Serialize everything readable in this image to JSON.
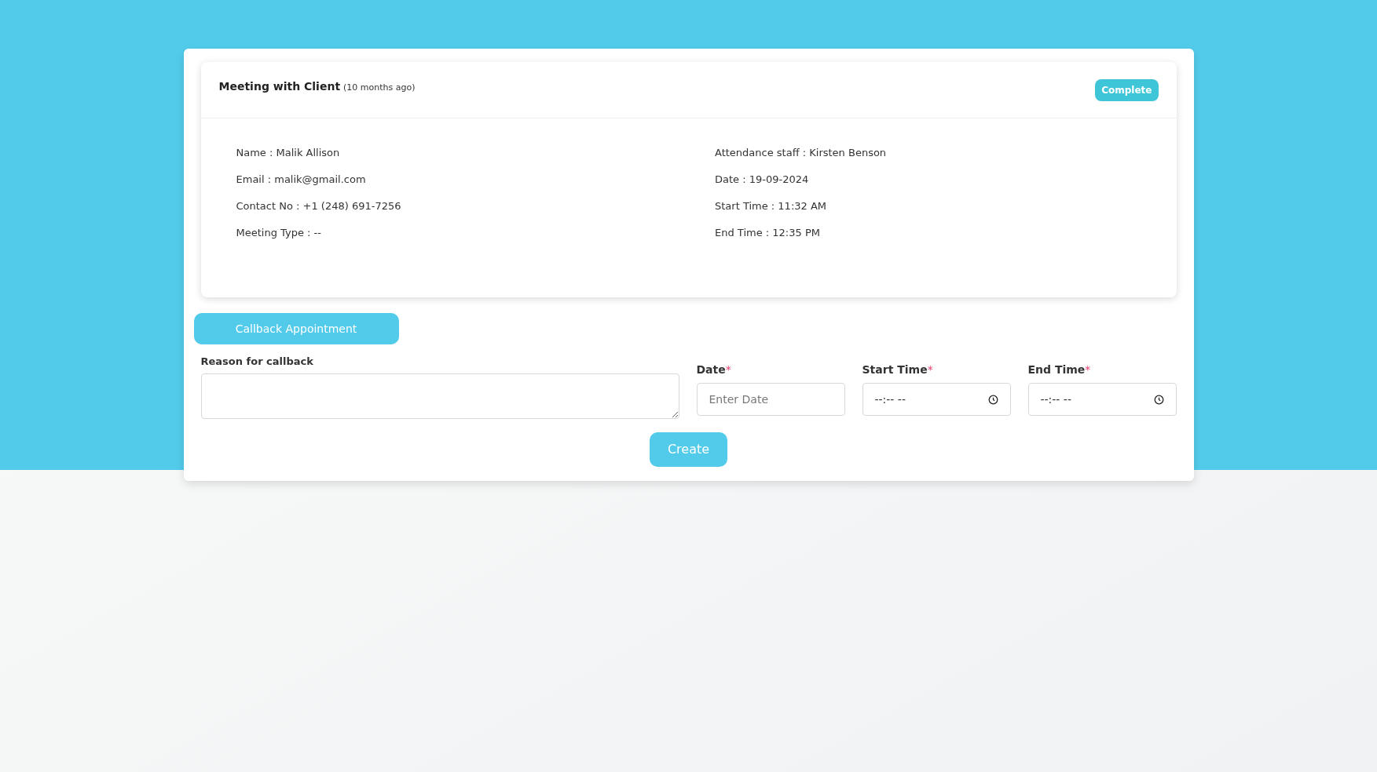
{
  "meeting": {
    "title": "Meeting with Client",
    "age": "(10 months ago)",
    "status": "Complete",
    "left": [
      "Name : Malik Allison",
      "Email : malik@gmail.com",
      "Contact No : +1 (248) 691-7256",
      "Meeting Type : --"
    ],
    "right": [
      "Attendance staff : Kirsten Benson",
      "Date : 19-09-2024",
      "Start Time : 11:32 AM",
      "End Time : 12:35 PM"
    ]
  },
  "callback_button": "Callback Appointment",
  "reason": {
    "label": "Reason for callback"
  },
  "fields": [
    {
      "kind": "date",
      "label": "Date",
      "mark": "*",
      "placeholder": "Enter Date"
    },
    {
      "kind": "time",
      "label": "Start Time",
      "mark": "*",
      "value": "--:-- --"
    },
    {
      "kind": "time",
      "label": "End Time",
      "mark": "*",
      "value": "--:-- --"
    }
  ],
  "create_button": "Create"
}
